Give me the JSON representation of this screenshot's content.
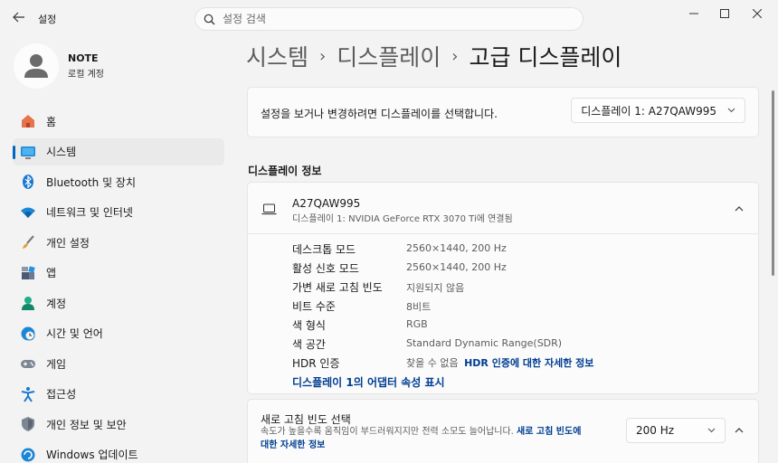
{
  "titlebar": {
    "app_title": "설정",
    "search_placeholder": "설정 검색"
  },
  "profile": {
    "name": "NOTE",
    "account_type": "로컬 계정"
  },
  "sidebar": {
    "items": [
      {
        "label": "홈",
        "icon": "home-icon"
      },
      {
        "label": "시스템",
        "icon": "system-icon",
        "active": true
      },
      {
        "label": "Bluetooth 및 장치",
        "icon": "bluetooth-icon"
      },
      {
        "label": "네트워크 및 인터넷",
        "icon": "wifi-icon"
      },
      {
        "label": "개인 설정",
        "icon": "brush-icon"
      },
      {
        "label": "앱",
        "icon": "apps-icon"
      },
      {
        "label": "계정",
        "icon": "account-icon"
      },
      {
        "label": "시간 및 언어",
        "icon": "globe-clock-icon"
      },
      {
        "label": "게임",
        "icon": "gamepad-icon"
      },
      {
        "label": "접근성",
        "icon": "accessibility-icon"
      },
      {
        "label": "개인 정보 및 보안",
        "icon": "shield-icon"
      },
      {
        "label": "Windows 업데이트",
        "icon": "update-icon"
      }
    ]
  },
  "breadcrumb": {
    "items": [
      "시스템",
      "디스플레이",
      "고급 디스플레이"
    ]
  },
  "display_select": {
    "prompt": "설정을 보거나 변경하려면 디스플레이를 선택합니다.",
    "selected": "디스플레이 1: A27QAW995"
  },
  "display_info": {
    "section_title": "디스플레이 정보",
    "monitor_name": "A27QAW995",
    "monitor_sub": "디스플레이 1: NVIDIA GeForce RTX 3070 Ti에 연결됨",
    "rows": [
      {
        "label": "데스크톱 모드",
        "value": "2560×1440, 200 Hz"
      },
      {
        "label": "활성 신호 모드",
        "value": "2560×1440, 200 Hz"
      },
      {
        "label": "가변 새로 고침 빈도",
        "value": "지원되지 않음"
      },
      {
        "label": "비트 수준",
        "value": "8비트"
      },
      {
        "label": "색 형식",
        "value": "RGB"
      },
      {
        "label": "색 공간",
        "value": "Standard Dynamic Range(SDR)"
      },
      {
        "label": "HDR 인증",
        "value": "찾을 수 없음"
      }
    ],
    "hdr_link": "HDR 인증에 대한 자세한 정보",
    "adapter_link": "디스플레이 1의 어댑터 속성 표시"
  },
  "refresh": {
    "title": "새로 고침 빈도 선택",
    "desc": "속도가 높을수록 움직임이 부드러워지지만 전력 소모도 늘어납니다.",
    "link_part1": "새로 고침 빈도에",
    "link_part2": "대한 자세한 정보",
    "value": "200 Hz"
  },
  "colors": {
    "accent": "#0067c0",
    "link": "#003e92"
  }
}
